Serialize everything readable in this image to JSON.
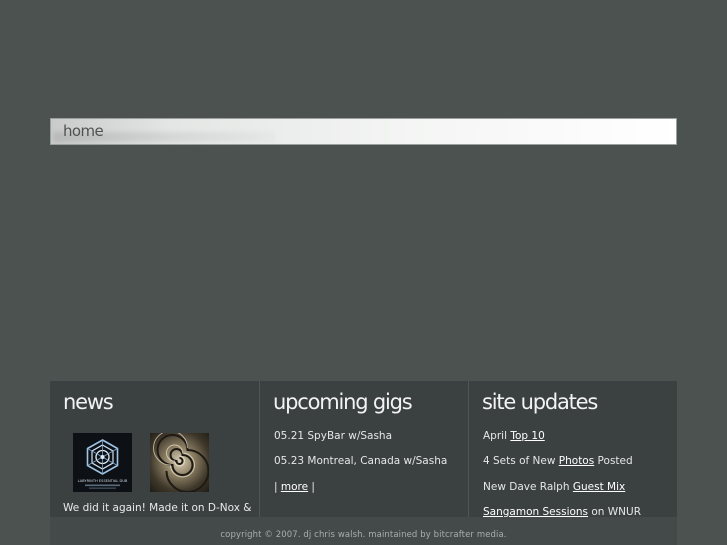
{
  "nav": {
    "home_label": "home"
  },
  "news": {
    "heading": "news",
    "thumb_icons": [
      "album-cover-icon",
      "album-cover-icon"
    ],
    "album1_caption": "LABYRINTH ESSENTIAL DUB",
    "text": "We did it again! Made it on D-Nox &"
  },
  "gigs": {
    "heading": "upcoming gigs",
    "items": [
      "05.21 SpyBar w/Sasha",
      "05.23 Montreal, Canada w/Sasha"
    ],
    "more_prefix": "| ",
    "more_link": "more",
    "more_suffix": " |"
  },
  "updates": {
    "heading": "site updates",
    "item1": {
      "pre": "April ",
      "link": "Top 10",
      "post": ""
    },
    "item2": {
      "pre": "4 Sets of New ",
      "link": "Photos",
      "post": " Posted"
    },
    "item3": {
      "pre": "New Dave Ralph ",
      "link": "Guest Mix",
      "post": ""
    },
    "item4": {
      "pre": "",
      "link": "Sangamon Sessions",
      "post": " on WNUR"
    }
  },
  "footer": {
    "copyright": "copyright © 2007. dj chris walsh. maintained by bitcrafter media."
  },
  "colors": {
    "background": "#4b5250",
    "panel": "#3a4140",
    "navbar": "#f4f5f4"
  }
}
